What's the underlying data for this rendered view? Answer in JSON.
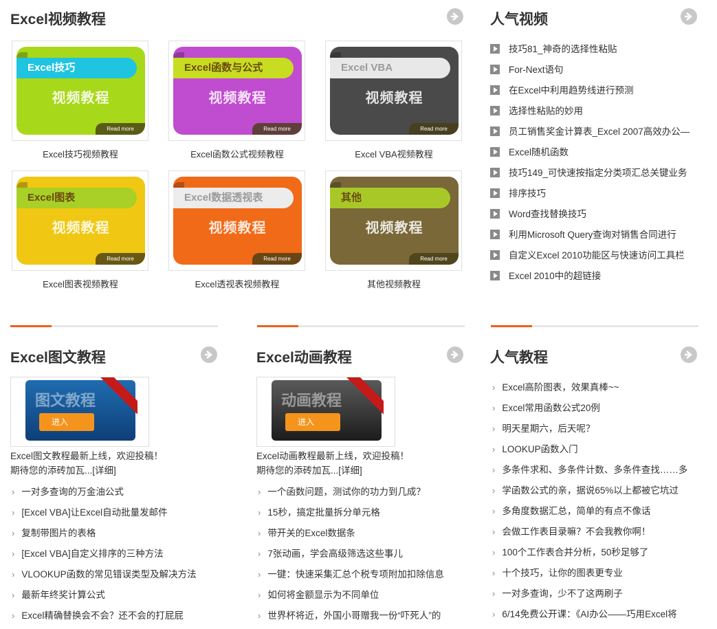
{
  "video_section": {
    "title": "Excel视频教程",
    "cards": [
      {
        "ribbon": "Excel技巧",
        "center": "视频教程",
        "read_more": "Read more",
        "caption": "Excel技巧视频教程",
        "color": "#a8d81a",
        "ribbon_color": "#1fc4e0"
      },
      {
        "ribbon": "Excel函数与公式",
        "center": "视频教程",
        "read_more": "Read more",
        "caption": "Excel函数公式视频教程",
        "color": "#c04cd0",
        "ribbon_color": "#c8dc22"
      },
      {
        "ribbon": "Excel VBA",
        "center": "视频教程",
        "read_more": "Read more",
        "caption": "Excel VBA视频教程",
        "color": "#4a4a4a",
        "ribbon_color": "#e8e8e8"
      },
      {
        "ribbon": "Excel图表",
        "center": "视频教程",
        "read_more": "Read more",
        "caption": "Excel图表视频教程",
        "color": "#f0c814",
        "ribbon_color": "#a8d026"
      },
      {
        "ribbon": "Excel数据透视表",
        "center": "视频教程",
        "read_more": "Read more",
        "caption": "Excel透视表视频教程",
        "color": "#f06a18",
        "ribbon_color": "#ececec"
      },
      {
        "ribbon": "其他",
        "center": "视频教程",
        "read_more": "Read more",
        "caption": "其他视频教程",
        "color": "#7a6838",
        "ribbon_color": "#a8c828"
      }
    ]
  },
  "popular_videos": {
    "title": "人气视频",
    "items": [
      "技巧81_神奇的选择性粘贴",
      "For-Next语句",
      "在Excel中利用趋势线进行预测",
      "选择性粘贴的妙用",
      "员工销售奖金计算表_Excel 2007高效办公—",
      "Excel随机函数",
      "技巧149_可快速按指定分类项汇总关键业务",
      "排序技巧",
      "Word查找替换技巧",
      "利用Microsoft Query查询对销售合同进行",
      "自定义Excel 2010功能区与快速访问工具栏",
      "Excel 2010中的超链接"
    ]
  },
  "graphic_tutorials": {
    "title": "Excel图文教程",
    "banner_text": "图文教程",
    "enter": "进入",
    "intro_line1": "Excel图文教程最新上线，欢迎投稿！",
    "intro_line2": "期待您的添砖加瓦...",
    "detail": "[详细]",
    "items": [
      "一对多查询的万金油公式",
      "[Excel VBA]让Excel自动批量发邮件",
      "复制带图片的表格",
      "[Excel VBA]自定义排序的三种方法",
      "VLOOKUP函数的常见错误类型及解决方法",
      "最新年终奖计算公式",
      "Excel精确替换会不会？还不会的打屁屁"
    ]
  },
  "animation_tutorials": {
    "title": "Excel动画教程",
    "banner_text": "动画教程",
    "enter": "进入",
    "intro_line1": "Excel动画教程最新上线，欢迎投稿！",
    "intro_line2": "期待您的添砖加瓦...",
    "detail": "[详细]",
    "items": [
      "一个函数问题，测试你的功力到几成？",
      "15秒，搞定批量拆分单元格",
      "带开关的Excel数据条",
      "7张动画，学会高级筛选这些事儿",
      "一键：快速采集汇总个税专项附加扣除信息",
      "如何将金额显示为不同单位",
      "世界杯将近，外国小哥赠我一份“吓死人”的"
    ]
  },
  "popular_tutorials": {
    "title": "人气教程",
    "items": [
      "Excel高阶图表，效果真棒~~",
      "Excel常用函数公式20例",
      "明天星期六，后天呢？",
      "LOOKUP函数入门",
      "多条件求和、多条件计数、多条件查找……多",
      "学函数公式的亲，据说65%以上都被它坑过",
      "多角度数据汇总，简单的有点不像话",
      "会做工作表目录嘛？不会我教你啊！",
      "100个工作表合并分析，50秒足够了",
      "十个技巧，让你的图表更专业",
      "一对多查询，少不了这两刷子",
      "6/14免费公开课：《AI办公——巧用Excel将"
    ]
  },
  "colors": {
    "accent": "#e8621a",
    "icon_gray": "#c8c8c8"
  }
}
